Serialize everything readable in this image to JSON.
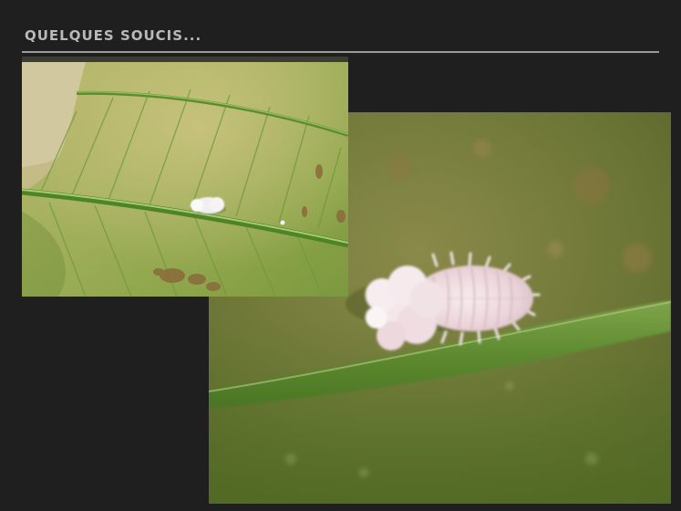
{
  "slide": {
    "title": "QUELQUES SOUCIS..."
  },
  "photos": [
    {
      "subject": "leaf-with-mealybug-small"
    },
    {
      "subject": "mealybug-closeup"
    }
  ]
}
